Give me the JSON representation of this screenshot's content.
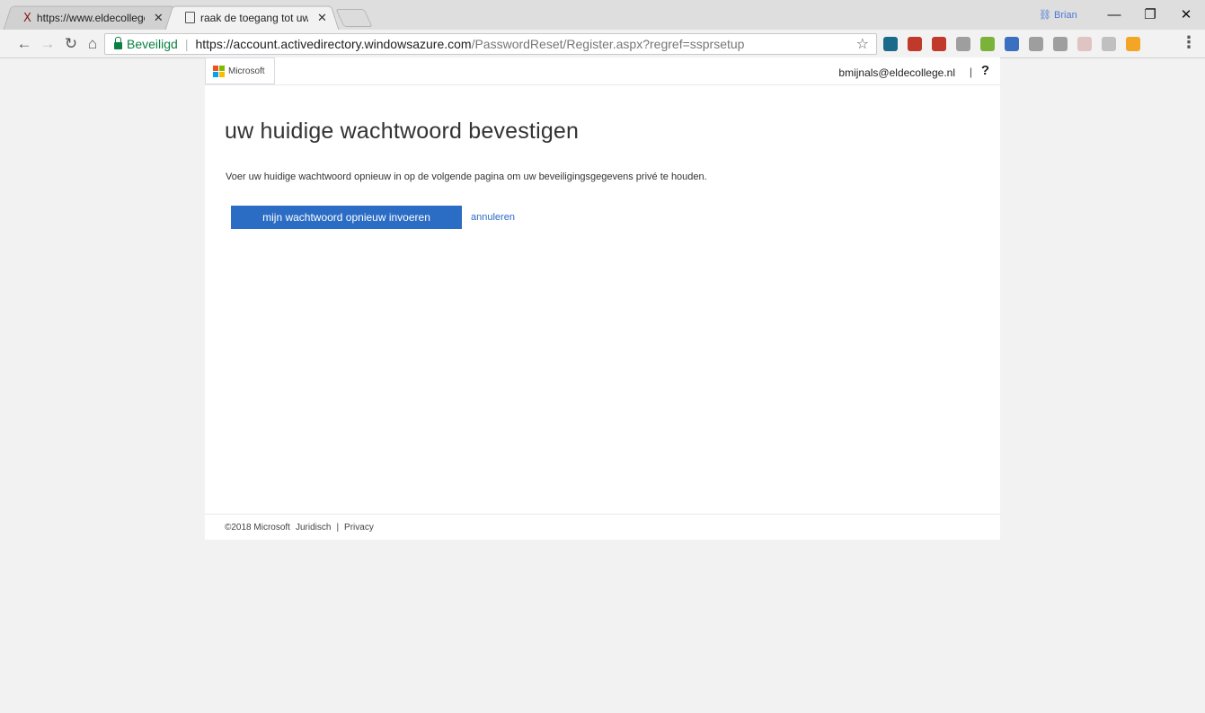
{
  "browser": {
    "tabs": [
      {
        "title": "https://www.eldecollege.",
        "close": "✕"
      },
      {
        "title": "raak de toegang tot uw a",
        "close": "✕"
      }
    ],
    "window_user": "Brian",
    "window_controls": {
      "minimize": "—",
      "restore": "❐",
      "close": "✕"
    },
    "nav": {
      "back": "←",
      "forward": "→",
      "reload": "↻",
      "home": "⌂"
    },
    "address": {
      "secure_label": "Beveiligd",
      "separator": "|",
      "url_host": "https://account.activedirectory.windowsazure.com",
      "url_path": "/PasswordReset/Register.aspx?regref=ssprsetup"
    },
    "bookmark_icon": "☆",
    "menu_icon": "⋮",
    "extension_colors": [
      "#1a6a8a",
      "#c0392b",
      "#c0392b",
      "#9e9e9e",
      "#7bb33a",
      "#3b6fbf",
      "#9e9e9e",
      "#9e9e9e",
      "#e0c3c3",
      "#c0c0c0",
      "#f4a526"
    ]
  },
  "page": {
    "logo_text": "Microsoft",
    "logo_colors": [
      "#f25022",
      "#7fba00",
      "#00a4ef",
      "#ffb900"
    ],
    "user_email": "bmijnals@eldecollege.nl",
    "divider": "|",
    "help_label": "?",
    "heading": "uw huidige wachtwoord bevestigen",
    "description": "Voer uw huidige wachtwoord opnieuw in op de volgende pagina om uw beveiligingsgegevens privé te houden.",
    "primary_button": "mijn wachtwoord opnieuw invoeren",
    "cancel_link": "annuleren",
    "footer": {
      "copyright": "©2018 Microsoft",
      "legal": "Juridisch",
      "separator": "|",
      "privacy": "Privacy"
    }
  }
}
